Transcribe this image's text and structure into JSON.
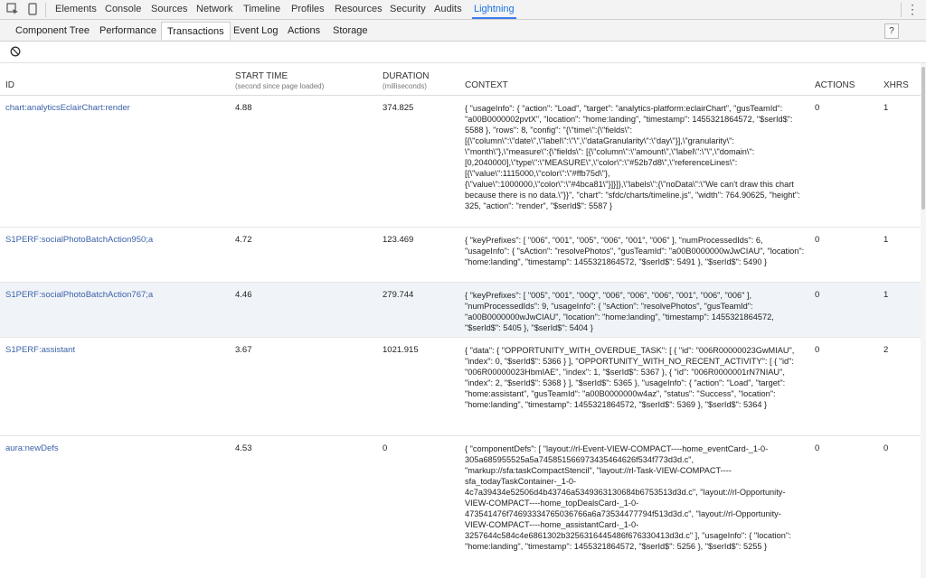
{
  "devtools_tabs": [
    "Elements",
    "Console",
    "Sources",
    "Network",
    "Timeline",
    "Profiles",
    "Resources",
    "Security",
    "Audits",
    "Lightning"
  ],
  "active_devtools_tab": "Lightning",
  "sub_tabs": [
    "Component Tree",
    "Performance",
    "Transactions",
    "Event Log",
    "Actions",
    "Storage"
  ],
  "active_sub_tab": "Transactions",
  "help_label": "?",
  "columns": {
    "id": "ID",
    "start_time": "START TIME",
    "start_time_sub": "(second since page loaded)",
    "duration": "DURATION",
    "duration_sub": "(milliseconds)",
    "context": "CONTEXT",
    "actions": "ACTIONS",
    "xhrs": "XHRS"
  },
  "rows": [
    {
      "id": "chart:analyticsEclairChart:render",
      "start": "4.88",
      "duration": "374.825",
      "context": "{ \"usageInfo\": { \"action\": \"Load\", \"target\": \"analytics-platform:eclairChart\", \"gusTeamId\": \"a00B0000002pvtX\", \"location\": \"home:landing\", \"timestamp\": 1455321864572, \"$serId$\": 5588 }, \"rows\": 8, \"config\": \"{\\\"time\\\":{\\\"fields\\\": [{\\\"column\\\":\\\"date\\\",\\\"label\\\":\\\"\\\",\\\"dataGranularity\\\":\\\"day\\\"}],\\\"granularity\\\": \\\"month\\\"},\\\"measure\\\":{\\\"fields\\\": [{\\\"column\\\":\\\"amount\\\",\\\"label\\\":\\\"\\\",\\\"domain\\\": [0,2040000],\\\"type\\\":\\\"MEASURE\\\",\\\"color\\\":\\\"#52b7d8\\\",\\\"referenceLines\\\": [{\\\"value\\\":1115000,\\\"color\\\":\\\"#ffb75d\\\"}, {\\\"value\\\":1000000,\\\"color\\\":\\\"#4bca81\\\"}]}]},\\\"labels\\\":{\\\"noData\\\":\\\"We can't draw this chart because there is no data.\\\"}}\", \"chart\": \"sfdc/charts/timeline.js\", \"width\": 764.90625, \"height\": 325, \"action\": \"render\", \"$serId$\": 5587 }",
      "actions": "0",
      "xhrs": "1"
    },
    {
      "id": "S1PERF:socialPhotoBatchAction950;a",
      "start": "4.72",
      "duration": "123.469",
      "context": "{ \"keyPrefixes\": [ \"006\", \"001\", \"005\", \"006\", \"001\", \"006\" ], \"numProcessedIds\": 6, \"usageInfo\": { \"sAction\": \"resolvePhotos\", \"gusTeamId\": \"a00B0000000wJwCIAU\", \"location\": \"home:landing\", \"timestamp\": 1455321864572, \"$serId$\": 5491 }, \"$serId$\": 5490 }",
      "actions": "0",
      "xhrs": "1"
    },
    {
      "id": "S1PERF:socialPhotoBatchAction767;a",
      "start": "4.46",
      "duration": "279.744",
      "context": "{ \"keyPrefixes\": [ \"005\", \"001\", \"00Q\", \"006\", \"006\", \"006\", \"001\", \"006\", \"006\" ], \"numProcessedIds\": 9, \"usageInfo\": { \"sAction\": \"resolvePhotos\", \"gusTeamId\": \"a00B0000000wJwCIAU\", \"location\": \"home:landing\", \"timestamp\": 1455321864572, \"$serId$\": 5405 }, \"$serId$\": 5404 }",
      "actions": "0",
      "xhrs": "1"
    },
    {
      "id": "S1PERF:assistant",
      "start": "3.67",
      "duration": "1021.915",
      "context": "{ \"data\": { \"OPPORTUNITY_WITH_OVERDUE_TASK\": [ { \"id\": \"006R00000023GwMIAU\", \"index\": 0, \"$serId$\": 5366 } ], \"OPPORTUNITY_WITH_NO_RECENT_ACTIVITY\": [ { \"id\": \"006R00000023HbmIAE\", \"index\": 1, \"$serId$\": 5367 }, { \"id\": \"006R0000001rN7NIAU\", \"index\": 2, \"$serId$\": 5368 } ], \"$serId$\": 5365 }, \"usageInfo\": { \"action\": \"Load\", \"target\": \"home:assistant\", \"gusTeamId\": \"a00B0000000w4az\", \"status\": \"Success\", \"location\": \"home:landing\", \"timestamp\": 1455321864572, \"$serId$\": 5369 }, \"$serId$\": 5364 }",
      "actions": "0",
      "xhrs": "2"
    },
    {
      "id": "aura:newDefs",
      "start": "4.53",
      "duration": "0",
      "context": "{ \"componentDefs\": [ \"layout://rl-Event-VIEW-COMPACT----home_eventCard-_1-0-305a685955525a5a745851566973435464626f534f773d3d.c\", \"markup://sfa:taskCompactStencil\", \"layout://rl-Task-VIEW-COMPACT----sfa_todayTaskContainer-_1-0-4c7a39434e52506d4b43746a5349363130684b6753513d3d.c\", \"layout://rl-Opportunity-VIEW-COMPACT----home_topDealsCard-_1-0-473541476f74693334765036766a6a73534477794f513d3d.c\", \"layout://rl-Opportunity-VIEW-COMPACT----home_assistantCard-_1-0-3257644c584c4e6861302b3256316445486f676330413d3d.c\" ], \"usageInfo\": { \"location\": \"home:landing\", \"timestamp\": 1455321864572, \"$serId$\": 5256 }, \"$serId$\": 5255 }",
      "actions": "0",
      "xhrs": "0"
    }
  ]
}
